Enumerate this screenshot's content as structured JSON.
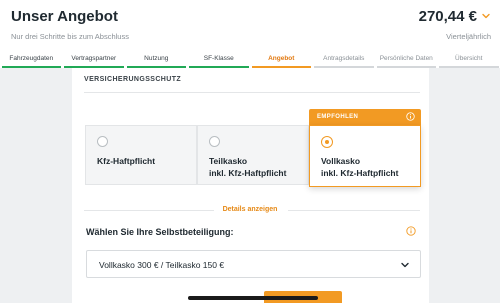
{
  "header": {
    "title": "Unser Angebot",
    "subtitle": "Nur drei Schritte bis zum Abschluss",
    "price": "270,44 €",
    "price_chevron_icon": "chevron-down-icon",
    "price_period": "Vierteljährlich"
  },
  "steps": [
    {
      "label": "Fahrzeugdaten",
      "state": "done"
    },
    {
      "label": "Vertragspartner",
      "state": "done"
    },
    {
      "label": "Nutzung",
      "state": "done"
    },
    {
      "label": "SF-Klasse",
      "state": "done"
    },
    {
      "label": "Angebot",
      "state": "active"
    },
    {
      "label": "Antragsdetails",
      "state": "todo"
    },
    {
      "label": "Persönliche Daten",
      "state": "todo"
    },
    {
      "label": "Übersicht",
      "state": "todo"
    }
  ],
  "coverage": {
    "section_label": "VERSICHERUNGSSCHUTZ",
    "options": [
      {
        "label_line1": "Kfz-Haftpflicht",
        "label_line2": "",
        "selected": false
      },
      {
        "label_line1": "Teilkasko",
        "label_line2": "inkl. Kfz-Haftpflicht",
        "selected": false
      },
      {
        "label_line1": "Vollkasko",
        "label_line2": "inkl. Kfz-Haftpflicht",
        "selected": true
      }
    ],
    "recommended_badge": "EMPFOHLEN",
    "info_icon": "info-icon"
  },
  "details_link": "Details anzeigen",
  "deductible": {
    "label": "Wählen Sie Ihre Selbstbeteiligung:",
    "selected_value": "Vollkasko 300 € / Teilkasko 150 €",
    "chevron_icon": "chevron-down-icon"
  },
  "colors": {
    "accent": "#f29a23",
    "done": "#21a956",
    "todo": "#d4d7da",
    "background": "#eef0f2"
  }
}
